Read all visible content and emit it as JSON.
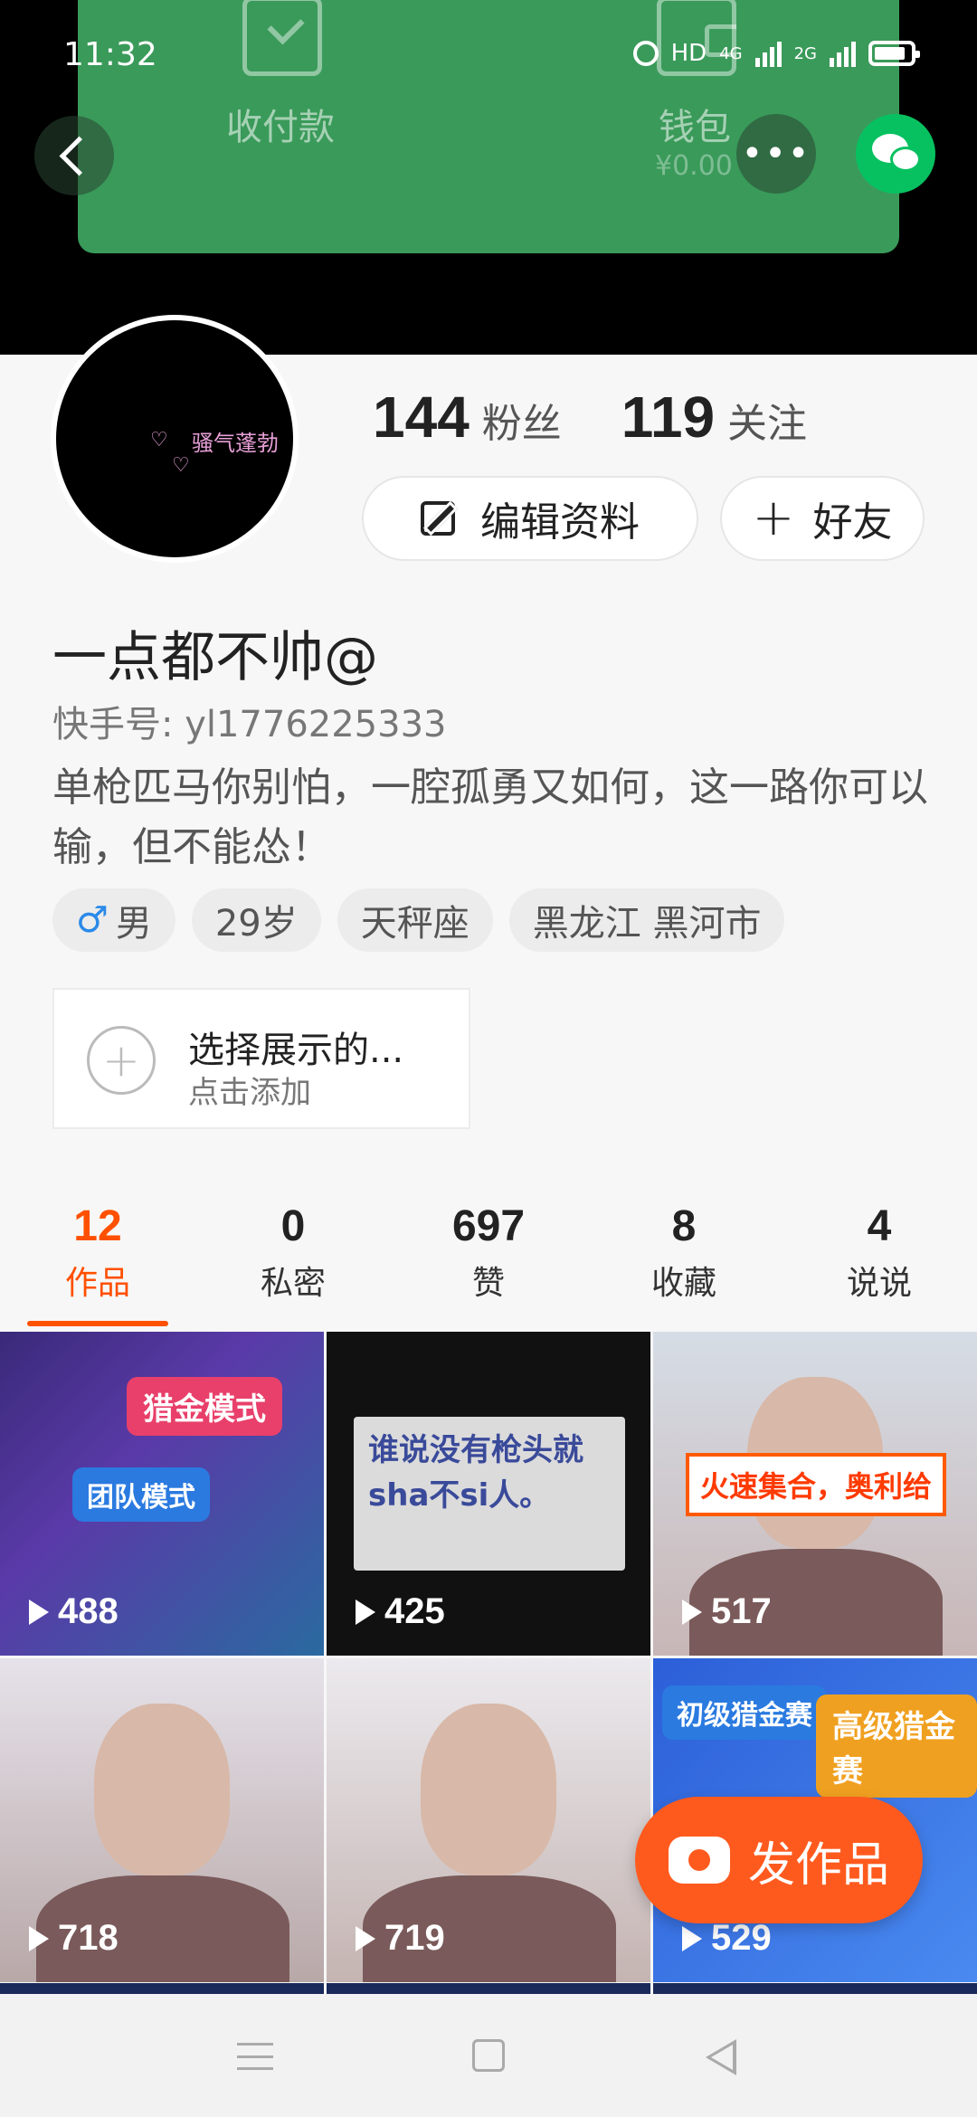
{
  "status_bar": {
    "time": "11:32",
    "hd": "HD",
    "net1": "4G",
    "net2": "2G"
  },
  "wallet_card": {
    "pay_label": "收付款",
    "wallet_label": "钱包",
    "balance": "¥0.00"
  },
  "header": {
    "more_label": "•••"
  },
  "profile": {
    "avatar_text": "骚气蓬勃",
    "followers_count": "144",
    "followers_label": "粉丝",
    "following_count": "119",
    "following_label": "关注",
    "edit_label": "编辑资料",
    "add_friend_label": "好友",
    "username": "一点都不帅@",
    "kuaishou_id": "快手号: yl1776225333",
    "bio": "单枪匹马你别怕，一腔孤勇又如何，这一路你可以输，但不能怂！",
    "tags": {
      "gender": "男",
      "age": "29岁",
      "zodiac": "天秤座",
      "location": "黑龙江 黑河市"
    }
  },
  "showcase": {
    "title": "选择展示的...",
    "subtitle": "点击添加"
  },
  "tabs": [
    {
      "count": "12",
      "label": "作品"
    },
    {
      "count": "0",
      "label": "私密"
    },
    {
      "count": "697",
      "label": "赞"
    },
    {
      "count": "8",
      "label": "收藏"
    },
    {
      "count": "4",
      "label": "说说"
    }
  ],
  "videos": [
    {
      "plays": "488",
      "badge1": "猎金模式",
      "badge2": "团队模式"
    },
    {
      "plays": "425",
      "caption": "谁说没有枪头就sha不si人。"
    },
    {
      "plays": "517",
      "banner": "火速集合，奥利给"
    },
    {
      "plays": "718"
    },
    {
      "plays": "719"
    },
    {
      "plays": "529",
      "badge1": "初级猎金赛",
      "badge2": "高级猎金赛"
    }
  ],
  "post_button_label": "发作品",
  "colors": {
    "accent": "#ff5000",
    "wechat": "#07c160"
  }
}
